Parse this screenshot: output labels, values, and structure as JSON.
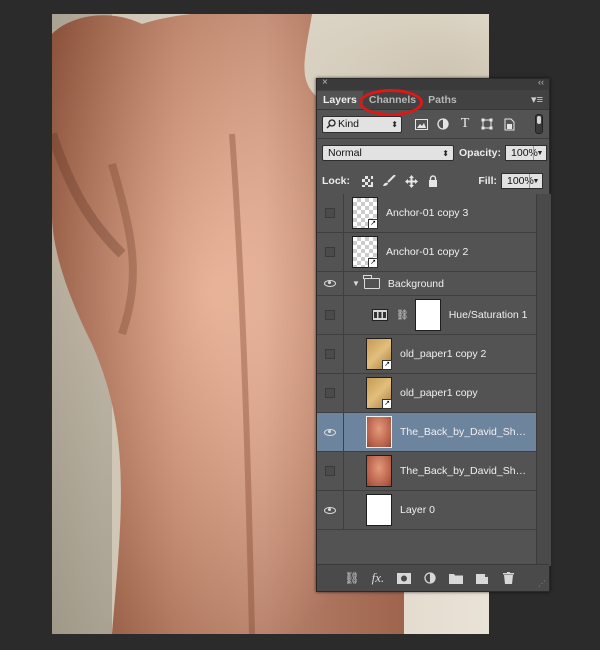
{
  "panel": {
    "close_glyph": "×",
    "collapse_glyph": "‹‹",
    "tabs": [
      {
        "label": "Layers",
        "active": true
      },
      {
        "label": "Channels",
        "active": false,
        "highlighted": true
      },
      {
        "label": "Paths",
        "active": false
      }
    ],
    "highlight_color": "#e11616",
    "filter": {
      "kind_label": "Kind"
    },
    "blend_mode": "Normal",
    "opacity_label": "Opacity:",
    "opacity_value": "100%",
    "lock_label": "Lock:",
    "fill_label": "Fill:",
    "fill_value": "100%",
    "layers": [
      {
        "name": "Anchor-01 copy 3",
        "visible": false,
        "thumb": "checker"
      },
      {
        "name": "Anchor-01 copy 2",
        "visible": false,
        "thumb": "checker"
      },
      {
        "name": "Background",
        "visible": true,
        "type": "group"
      },
      {
        "name": "Hue/Saturation 1",
        "visible": false,
        "type": "adjustment"
      },
      {
        "name": "old_paper1 copy 2",
        "visible": false,
        "thumb": "paper"
      },
      {
        "name": "old_paper1 copy",
        "visible": false,
        "thumb": "paper"
      },
      {
        "name": "The_Back_by_David_Shan...",
        "visible": true,
        "thumb": "skin",
        "selected": true
      },
      {
        "name": "The_Back_by_David_Shan...",
        "visible": false,
        "thumb": "skin"
      },
      {
        "name": "Layer 0",
        "visible": true,
        "thumb": "white"
      }
    ],
    "selected_color": "#6d849e"
  }
}
